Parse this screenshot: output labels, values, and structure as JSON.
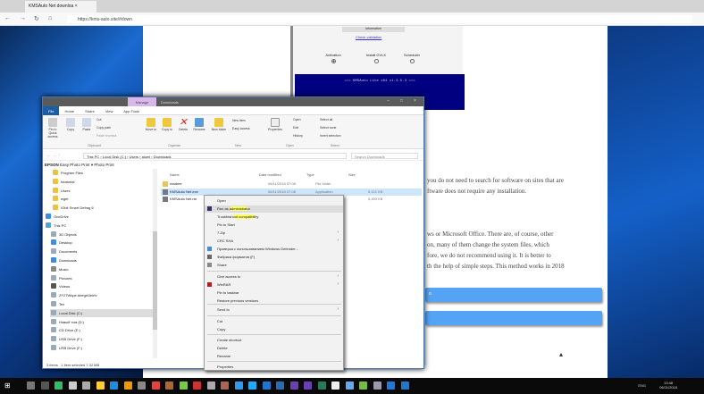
{
  "browser": {
    "tab_title": "KMSAuto Net downloa",
    "url": "https://kms-auto.site/#down",
    "back": "←",
    "forward": "→",
    "refresh": "↻",
    "home": "⌂"
  },
  "kms_panel": {
    "info_button": "Information",
    "check_link": "Check validation",
    "radios": [
      {
        "label": "Activation",
        "selected": true
      },
      {
        "label": "Install GVLK",
        "selected": false
      },
      {
        "label": "Scheduler",
        "selected": false
      }
    ],
    "console_text": "=== KMSAuto Lite x64 v1.3.5.3 ==="
  },
  "article": {
    "lines": [
      "you do not need to search for software on sites that are",
      "ftware does not require any installation.",
      "",
      "ws or Microsoft Office. There are, of course, other",
      "on, many of them change the system files, which",
      "fore, we do not recommend using it. It is better to",
      "th the help of simple steps. This method works in 2018"
    ],
    "button1_label": "o"
  },
  "explorer": {
    "title": "Downloads",
    "manage_tab": "Manage",
    "ribbon_tabs": [
      "File",
      "Home",
      "Share",
      "View",
      "App Tools"
    ],
    "ribbon": {
      "pin": "Pin to Quick access",
      "copy": "Copy",
      "paste": "Paste",
      "cut": "Cut",
      "copy_path": "Copy path",
      "paste_shortcut": "Paste shortcut",
      "move_to": "Move to",
      "copy_to": "Copy to",
      "delete": "Delete",
      "rename": "Rename",
      "new_folder": "New folder",
      "new_item": "New item",
      "easy_access": "Easy access",
      "properties": "Properties",
      "open": "Open",
      "edit": "Edit",
      "history": "History",
      "select_all": "Select all",
      "select_none": "Select none",
      "invert_selection": "Invert selection",
      "groups": [
        "Clipboard",
        "Organize",
        "New",
        "Open",
        "Select"
      ]
    },
    "path": [
      "This PC",
      "Local Disk (C:)",
      "Users",
      "alumi",
      "Downloads"
    ],
    "search_placeholder": "Search Downloads",
    "quick_bar": {
      "epson": "EPSON",
      "easy_photo": "Easy Photo Print",
      "photo_print": "Photo Print"
    },
    "nav": [
      "Program Files",
      "tutatorial",
      "Users",
      "wget",
      "IObit Smart Defrag 6",
      "OneDrive",
      "This PC",
      "3D Objects",
      "Desktop",
      "Documents",
      "Downloads",
      "Music",
      "Pictures",
      "Videos",
      "ZF2TWkpe.bbegelJeirfv",
      "Tex",
      "Local Disk (C:)",
      "Новый том (D:)",
      "CD Drive (E:)",
      "USB Drive (F:)",
      "USB Drive (F:)"
    ],
    "columns": [
      "Name",
      "Date modified",
      "Type",
      "Size"
    ],
    "files": [
      {
        "name": "readme",
        "date": "06/11/2018 07:08",
        "type": "File folder",
        "size": ""
      },
      {
        "name": "KMSAuto Net.exe",
        "date": "06/11/2018 07:08",
        "type": "Application",
        "size": "5,121 KB"
      },
      {
        "name": "KMSAuto Net.rar",
        "date": "06/11/2018 07:08",
        "type": "WinRAR archive",
        "size": "5,300 KB"
      }
    ],
    "status": {
      "items": "3 items",
      "selected": "1 item selected  7.32 MB"
    }
  },
  "context_menu": [
    "Open",
    "Run as administrator",
    "Troubleshoot compatibility",
    "Pin to Start",
    "7-Zip",
    "CRC SHA",
    "Проверка с использованием Windows Defender...",
    "Фабрика форматов (F)",
    "Share",
    "Give access to",
    "WinRAR",
    "Pin to taskbar",
    "Restore previous versions",
    "Send to",
    "Cut",
    "Copy",
    "Create shortcut",
    "Delete",
    "Rename",
    "Properties"
  ],
  "taskbar": {
    "time": "13:48",
    "date": "06/11/2018",
    "lang": "ENG"
  },
  "colors": {
    "accent": "#1a5ea8",
    "console": "#000080",
    "article_button": "#55a3f5"
  }
}
